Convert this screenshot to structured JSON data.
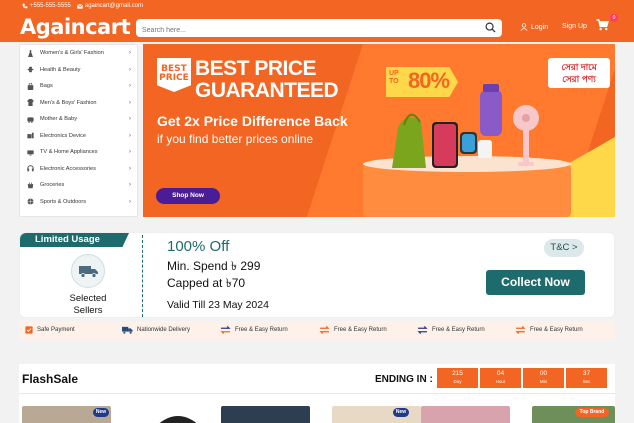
{
  "header": {
    "phone": "+555-555-5555",
    "email": "againcart@gmail.com",
    "logo": "Againcart",
    "search_placeholder": "Search here...",
    "login": "Login",
    "signup": "Sign Up",
    "cart_count": "0"
  },
  "sidebar": {
    "items": [
      {
        "label": "Women's & Girls' Fashion",
        "icon": "dress-icon"
      },
      {
        "label": "Health & Beauty",
        "icon": "health-icon"
      },
      {
        "label": "Bags",
        "icon": "bag-icon"
      },
      {
        "label": "Men's & Boys' Fashion",
        "icon": "shirt-icon"
      },
      {
        "label": "Mother & Baby",
        "icon": "baby-icon"
      },
      {
        "label": "Electronics Device",
        "icon": "device-icon"
      },
      {
        "label": "TV & Home Appliances",
        "icon": "tv-icon"
      },
      {
        "label": "Electronic Accessories",
        "icon": "accessory-icon"
      },
      {
        "label": "Groceries",
        "icon": "grocery-icon"
      },
      {
        "label": "Sports & Outdoors",
        "icon": "ball-icon"
      }
    ]
  },
  "banner": {
    "badge": "BEST PRICE",
    "headline_1": "BEST PRICE",
    "headline_2": "GUARANTEED",
    "subhead": "Get 2x Price Difference Back",
    "subtext": "if you find better prices online",
    "cta": "Shop Now",
    "upto_label": "UP TO",
    "upto_value": "80%",
    "bangla_1": "সেরা দামে",
    "bangla_2": "সেরা পণ্য"
  },
  "coupon": {
    "tab": "Limited Usage",
    "seller_line1": "Selected",
    "seller_line2": "Sellers",
    "percent": "100% Off",
    "min_spend": "Min. Spend ৳ 299",
    "capped": "Capped at ৳70",
    "valid": "Valid Till 23 May 2024",
    "tc": "T&C >",
    "collect": "Collect Now"
  },
  "features": [
    {
      "label": "Safe Payment",
      "icon": "shield-icon"
    },
    {
      "label": "Nationwide Delivery",
      "icon": "truck-icon"
    },
    {
      "label": "Free & Easy Return",
      "icon": "swap-icon"
    },
    {
      "label": "Free & Easy Return",
      "icon": "swap-icon"
    },
    {
      "label": "Free & Easy Return",
      "icon": "swap-icon"
    },
    {
      "label": "Free & Easy Return",
      "icon": "swap-icon"
    }
  ],
  "flashsale": {
    "title": "FlashSale",
    "ending_label": "ENDING IN :",
    "timer": [
      {
        "value": "215",
        "unit": "Day"
      },
      {
        "value": "04",
        "unit": "Hour"
      },
      {
        "value": "00",
        "unit": "Min"
      },
      {
        "value": "37",
        "unit": "Sec"
      }
    ],
    "badges": {
      "new": "New",
      "top": "Top Brand"
    }
  },
  "colors": {
    "brand": "#f26522",
    "teal": "#1e6b6e",
    "purple": "#4a1d96"
  }
}
